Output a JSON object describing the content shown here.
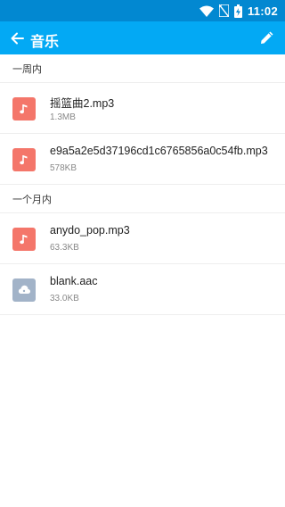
{
  "status": {
    "time": "11:02"
  },
  "header": {
    "title": "音乐"
  },
  "sections": [
    {
      "label": "一周内",
      "files": [
        {
          "name": "摇篮曲2.mp3",
          "size": "1.3MB",
          "icon": "music-note-icon",
          "color": "#f4766a"
        },
        {
          "name": "e9a5a2e5d37196cd1c6765856a0c54fb.mp3",
          "size": "578KB",
          "icon": "music-note-icon",
          "color": "#f4766a"
        }
      ]
    },
    {
      "label": "一个月内",
      "files": [
        {
          "name": "anydo_pop.mp3",
          "size": "63.3KB",
          "icon": "music-note-icon",
          "color": "#f4766a"
        },
        {
          "name": "blank.aac",
          "size": "33.0KB",
          "icon": "cloud-file-icon",
          "color": "#a2b3c8"
        }
      ]
    }
  ]
}
